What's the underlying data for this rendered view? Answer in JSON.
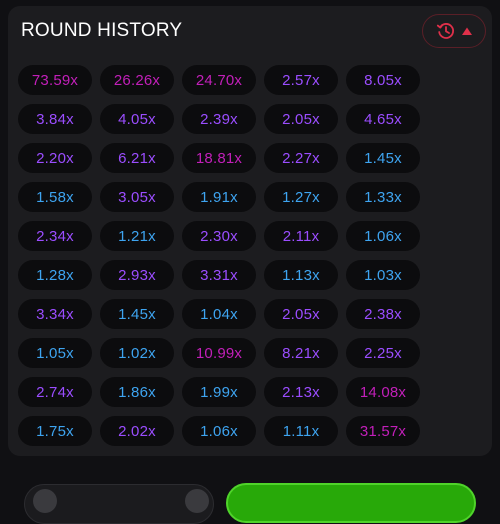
{
  "header": {
    "title": "ROUND HISTORY"
  },
  "colors": {
    "blue": "#3ea4f0",
    "purple": "#9b4dff",
    "pink": "#c21fb9",
    "history_accent": "#e0304a",
    "bet_green": "#28a909"
  },
  "icons": {
    "history": "history-icon",
    "toggle": "chevron-up-icon"
  },
  "rounds": [
    {
      "value": "73.59x",
      "tier": "pink"
    },
    {
      "value": "26.26x",
      "tier": "pink"
    },
    {
      "value": "24.70x",
      "tier": "pink"
    },
    {
      "value": "2.57x",
      "tier": "purple"
    },
    {
      "value": "8.05x",
      "tier": "purple"
    },
    {
      "value": "3.84x",
      "tier": "purple"
    },
    {
      "value": "4.05x",
      "tier": "purple"
    },
    {
      "value": "2.39x",
      "tier": "purple"
    },
    {
      "value": "2.05x",
      "tier": "purple"
    },
    {
      "value": "4.65x",
      "tier": "purple"
    },
    {
      "value": "2.20x",
      "tier": "purple"
    },
    {
      "value": "6.21x",
      "tier": "purple"
    },
    {
      "value": "18.81x",
      "tier": "pink"
    },
    {
      "value": "2.27x",
      "tier": "purple"
    },
    {
      "value": "1.45x",
      "tier": "blue"
    },
    {
      "value": "1.58x",
      "tier": "blue"
    },
    {
      "value": "3.05x",
      "tier": "purple"
    },
    {
      "value": "1.91x",
      "tier": "blue"
    },
    {
      "value": "1.27x",
      "tier": "blue"
    },
    {
      "value": "1.33x",
      "tier": "blue"
    },
    {
      "value": "2.34x",
      "tier": "purple"
    },
    {
      "value": "1.21x",
      "tier": "blue"
    },
    {
      "value": "2.30x",
      "tier": "purple"
    },
    {
      "value": "2.11x",
      "tier": "purple"
    },
    {
      "value": "1.06x",
      "tier": "blue"
    },
    {
      "value": "1.28x",
      "tier": "blue"
    },
    {
      "value": "2.93x",
      "tier": "purple"
    },
    {
      "value": "3.31x",
      "tier": "purple"
    },
    {
      "value": "1.13x",
      "tier": "blue"
    },
    {
      "value": "1.03x",
      "tier": "blue"
    },
    {
      "value": "3.34x",
      "tier": "purple"
    },
    {
      "value": "1.45x",
      "tier": "blue"
    },
    {
      "value": "1.04x",
      "tier": "blue"
    },
    {
      "value": "2.05x",
      "tier": "purple"
    },
    {
      "value": "2.38x",
      "tier": "purple"
    },
    {
      "value": "1.05x",
      "tier": "blue"
    },
    {
      "value": "1.02x",
      "tier": "blue"
    },
    {
      "value": "10.99x",
      "tier": "pink"
    },
    {
      "value": "8.21x",
      "tier": "purple"
    },
    {
      "value": "2.25x",
      "tier": "purple"
    },
    {
      "value": "2.74x",
      "tier": "purple"
    },
    {
      "value": "1.86x",
      "tier": "blue"
    },
    {
      "value": "1.99x",
      "tier": "blue"
    },
    {
      "value": "2.13x",
      "tier": "purple"
    },
    {
      "value": "14.08x",
      "tier": "pink"
    },
    {
      "value": "1.75x",
      "tier": "blue"
    },
    {
      "value": "2.02x",
      "tier": "purple"
    },
    {
      "value": "1.06x",
      "tier": "blue"
    },
    {
      "value": "1.11x",
      "tier": "blue"
    },
    {
      "value": "31.57x",
      "tier": "pink"
    }
  ]
}
